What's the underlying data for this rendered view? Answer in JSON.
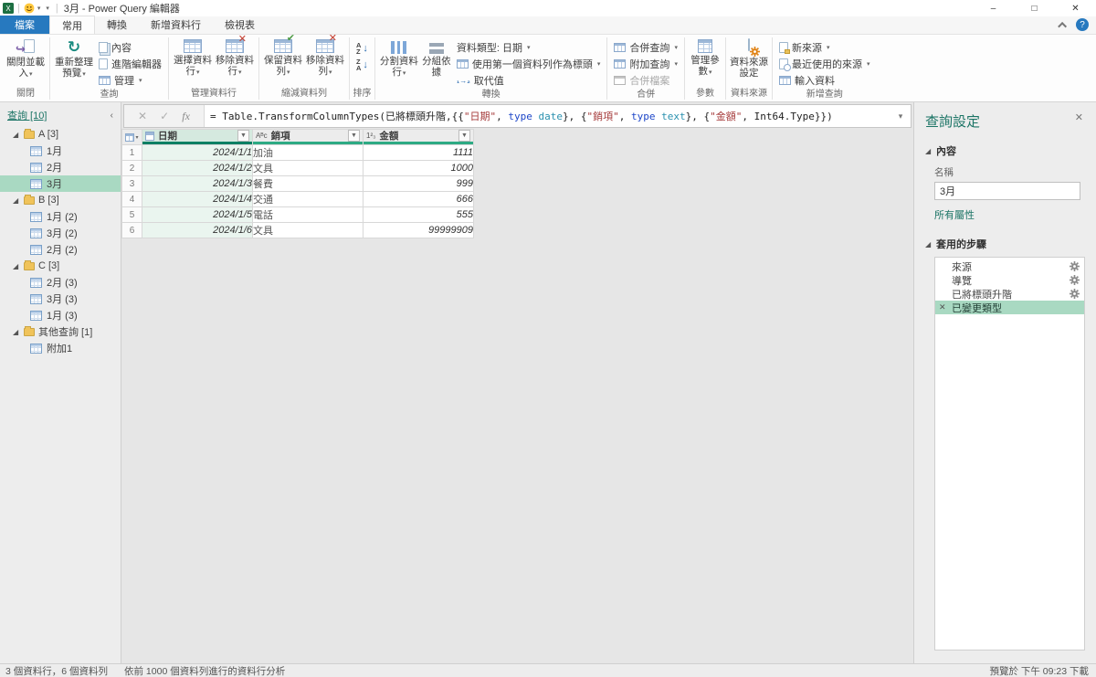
{
  "titlebar": {
    "title": "3月 - Power Query 編輯器",
    "minimize": "–",
    "maximize": "□",
    "close": "✕"
  },
  "tabs": {
    "file": "檔案",
    "home": "常用",
    "transform": "轉換",
    "add_column": "新增資料行",
    "view": "檢視表"
  },
  "ribbon": {
    "close_load": "關閉並載入",
    "close_group": "關閉",
    "refresh": "重新整理預覽",
    "props": "內容",
    "adv_editor": "進階編輯器",
    "manage": "管理",
    "query_group": "查詢",
    "choose_cols": "選擇資料行",
    "remove_cols": "移除資料行",
    "manage_cols_group": "管理資料行",
    "keep_rows": "保留資料列",
    "remove_rows": "移除資料列",
    "reduce_rows_group": "縮減資料列",
    "sort_group": "排序",
    "split_col": "分割資料行",
    "group_by": "分組依據",
    "data_type": "資料類型: 日期",
    "first_row_header": "使用第一個資料列作為標頭",
    "replace_values": "取代值",
    "transform_group": "轉換",
    "merge_queries": "合併查詢",
    "append_queries": "附加查詢",
    "combine_files": "合併檔案",
    "combine_group": "合併",
    "manage_params": "管理參數",
    "params_group": "參數",
    "datasource_settings": "資料來源設定",
    "datasource_group": "資料來源",
    "new_source": "新來源",
    "recent_sources": "最近使用的來源",
    "enter_data": "輸入資料",
    "new_query_group": "新增查詢"
  },
  "formula_bar": {
    "segments": [
      {
        "text": "= Table.TransformColumnTypes(已將標頭升階,{{"
      },
      {
        "text": "\"日期\""
      },
      {
        "text": ", "
      },
      {
        "text": "type"
      },
      {
        "text": " "
      },
      {
        "text": "date"
      },
      {
        "text": "}, {"
      },
      {
        "text": "\"銷項\""
      },
      {
        "text": ", "
      },
      {
        "text": "type"
      },
      {
        "text": " "
      },
      {
        "text": "text"
      },
      {
        "text": "}, {"
      },
      {
        "text": "\"金額\""
      },
      {
        "text": ", Int64.Type}})"
      }
    ]
  },
  "sidebar": {
    "header": "查詢 [10]",
    "collapse_icon": "‹",
    "groups": [
      {
        "label": "A [3]",
        "items": [
          {
            "label": "1月"
          },
          {
            "label": "2月"
          },
          {
            "label": "3月",
            "selected": true
          }
        ]
      },
      {
        "label": "B [3]",
        "items": [
          {
            "label": "1月 (2)"
          },
          {
            "label": "3月 (2)"
          },
          {
            "label": "2月 (2)"
          }
        ]
      },
      {
        "label": "C [3]",
        "items": [
          {
            "label": "2月 (3)"
          },
          {
            "label": "3月 (3)"
          },
          {
            "label": "1月 (3)"
          }
        ]
      },
      {
        "label": "其他查詢 [1]",
        "items": [
          {
            "label": "附加1"
          }
        ]
      }
    ]
  },
  "table": {
    "columns": [
      {
        "name": "日期",
        "type": "date"
      },
      {
        "name": "銷項",
        "type": "text"
      },
      {
        "name": "金額",
        "type": "number"
      }
    ],
    "rows": [
      {
        "num": "1",
        "date": "2024/1/1",
        "item": "加油",
        "amount": "1111"
      },
      {
        "num": "2",
        "date": "2024/1/2",
        "item": "文具",
        "amount": "1000"
      },
      {
        "num": "3",
        "date": "2024/1/3",
        "item": "餐費",
        "amount": "999"
      },
      {
        "num": "4",
        "date": "2024/1/4",
        "item": "交通",
        "amount": "666"
      },
      {
        "num": "5",
        "date": "2024/1/5",
        "item": "電話",
        "amount": "555"
      },
      {
        "num": "6",
        "date": "2024/1/6",
        "item": "文具",
        "amount": "99999909"
      }
    ]
  },
  "settings": {
    "title": "查詢設定",
    "properties_header": "內容",
    "name_label": "名稱",
    "name_value": "3月",
    "all_props": "所有屬性",
    "steps_header": "套用的步驟",
    "steps": [
      {
        "label": "來源"
      },
      {
        "label": "導覽"
      },
      {
        "label": "已將標頭升階"
      },
      {
        "label": "已變更類型",
        "selected": true
      }
    ]
  },
  "statusbar": {
    "left": "3 個資料行，6 個資料列",
    "middle": "依前 1000 個資料列進行的資料行分析",
    "right": "預覽於 下午 09:23 下載"
  },
  "colors": {
    "accent_green_selection": "#a9d9c2",
    "accent_teal_text": "#1b7465",
    "file_tab_blue": "#2779bf",
    "quality_bar": "#0c8064"
  }
}
